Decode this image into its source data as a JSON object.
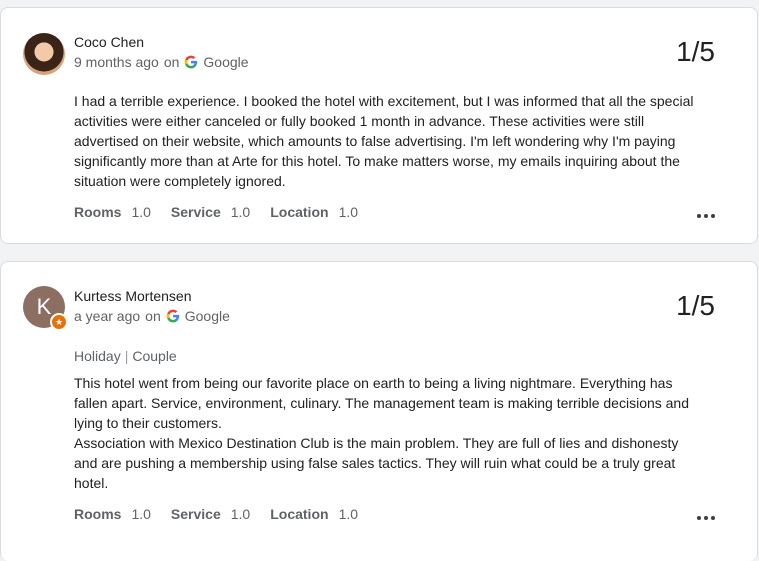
{
  "reviews": [
    {
      "author": "Coco Chen",
      "time": "9 months ago",
      "on_word": "on",
      "source": "Google",
      "rating": "1/5",
      "tags": [],
      "text": [
        "I had a terrible experience. I booked the hotel with excitement, but I was informed that all the special activities were either canceled or fully booked 1 month in advance. These activities were still advertised on their website, which amounts to false advertising. I'm left wondering why I'm paying significantly more than at Arte for this hotel. To make matters worse, my emails inquiring about the situation were completely ignored."
      ],
      "scores": [
        {
          "label": "Rooms",
          "value": "1.0"
        },
        {
          "label": "Service",
          "value": "1.0"
        },
        {
          "label": "Location",
          "value": "1.0"
        }
      ],
      "avatar_icon": "user-photo"
    },
    {
      "author": "Kurtess Mortensen",
      "avatar_letter": "K",
      "time": "a year ago",
      "on_word": "on",
      "source": "Google",
      "rating": "1/5",
      "tags": [
        "Holiday",
        "Couple"
      ],
      "tag_separator": "|",
      "text": [
        "This hotel went from being our favorite place on earth to being a living nightmare. Everything has fallen apart. Service, environment, culinary. The management team is making terrible decisions and lying to their customers.",
        "Association with Mexico Destination Club is the main problem. They are full of lies and dishonesty and are pushing a membership using false sales tactics. They will ruin what could be a truly great hotel."
      ],
      "scores": [
        {
          "label": "Rooms",
          "value": "1.0"
        },
        {
          "label": "Service",
          "value": "1.0"
        },
        {
          "label": "Location",
          "value": "1.0"
        }
      ],
      "badge_icon": "local-guide-star"
    }
  ],
  "colors": {
    "accent_google_blue": "#4285f4",
    "local_guide_badge": "#e8710a",
    "avatar_letter_bg": "#8c6e63"
  }
}
